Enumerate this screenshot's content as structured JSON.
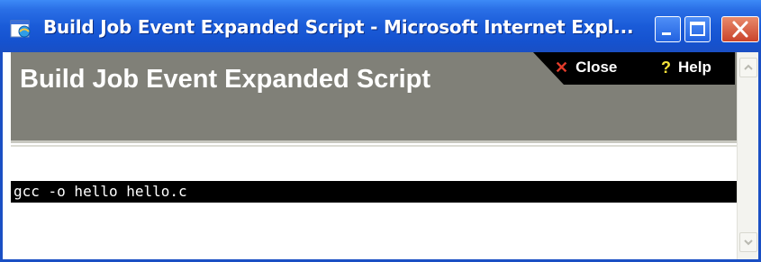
{
  "window": {
    "title": "Build Job Event Expanded Script - Microsoft Internet Expl...",
    "app_icon": "ie-page-icon",
    "controls": [
      "minimize-icon",
      "maximize-icon",
      "close-icon"
    ]
  },
  "header": {
    "title": "Build Job Event Expanded Script"
  },
  "toolbar": {
    "close_label": "Close",
    "close_icon": "x-icon",
    "help_label": "Help",
    "help_icon": "question-icon"
  },
  "script": {
    "line": "gcc -o hello hello.c"
  },
  "colors": {
    "titlebar": "#1a5bd8",
    "header_bg": "#808078",
    "script_bg": "#000000",
    "close_icon": "#e23b2a",
    "help_icon": "#f4e23a"
  }
}
